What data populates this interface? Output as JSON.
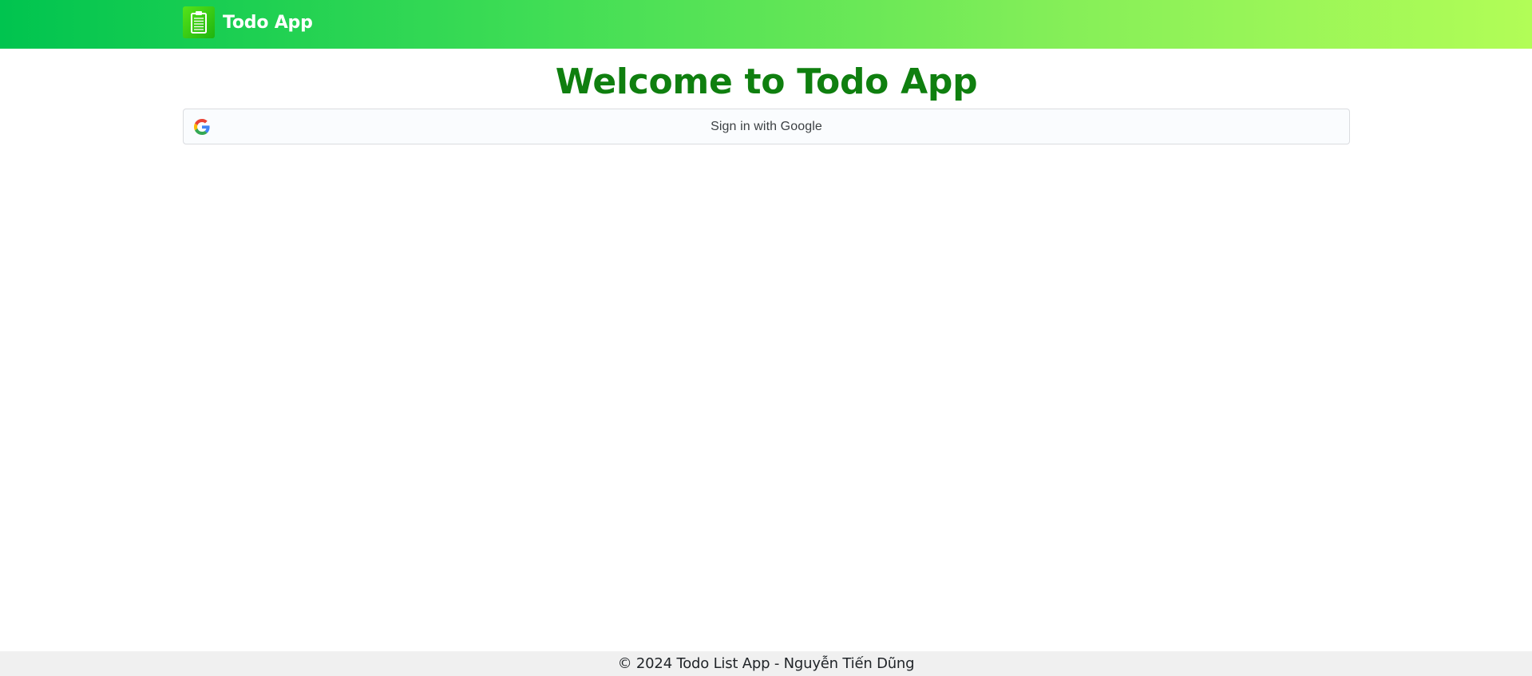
{
  "header": {
    "brand_name": "Todo App",
    "logo_icon": "clipboard-icon",
    "gradient_colors": [
      "#00c44f",
      "#b2fd57"
    ]
  },
  "main": {
    "title": "Welcome to Todo App",
    "title_color": "#0f7f0f",
    "google_button": {
      "label": "Sign in with Google",
      "icon": "google-g-icon"
    }
  },
  "footer": {
    "text": "© 2024 Todo List App - Nguyễn Tiến Dũng"
  }
}
